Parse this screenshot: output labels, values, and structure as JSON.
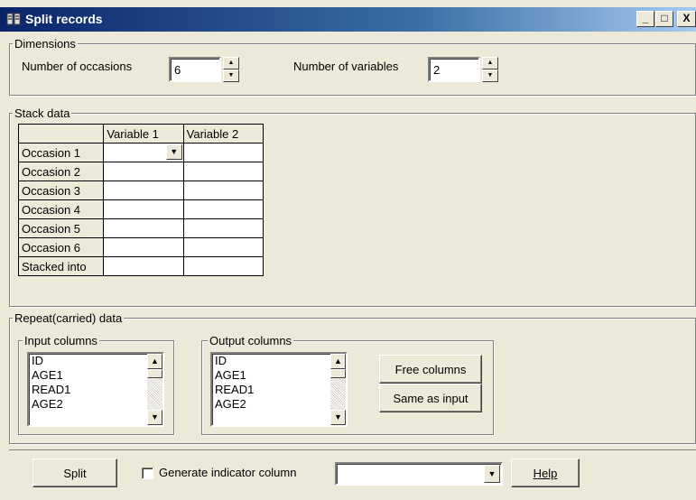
{
  "window": {
    "title": "Split records",
    "minimize_glyph": "_",
    "maximize_glyph": "□",
    "close_glyph": "X"
  },
  "dimensions": {
    "legend": "Dimensions",
    "occasions_label": "Number of occasions",
    "occasions_value": "6",
    "variables_label": "Number of variables",
    "variables_value": "2"
  },
  "stack": {
    "legend": "Stack data",
    "column_headers": [
      "Variable   1",
      "Variable   2"
    ],
    "row_headers": [
      "Occasion 1",
      "Occasion 2",
      "Occasion 3",
      "Occasion 4",
      "Occasion 5",
      "Occasion 6",
      "Stacked into"
    ]
  },
  "repeat": {
    "legend": "Repeat(carried) data",
    "input": {
      "legend": "Input columns",
      "items": [
        "ID",
        "AGE1",
        "READ1",
        "AGE2"
      ]
    },
    "output": {
      "legend": "Output columns",
      "items": [
        "ID",
        "AGE1",
        "READ1",
        "AGE2"
      ]
    },
    "free_columns_label": "Free columns",
    "same_as_input_label": "Same as input"
  },
  "footer": {
    "split_label": "Split",
    "indicator_label": "Generate indicator column",
    "indicator_checked": false,
    "indicator_select_value": "",
    "help_label": "Help"
  },
  "colors": {
    "titlebar_start": "#0a246a",
    "titlebar_end": "#a6caf0",
    "face": "#ece9d8"
  },
  "icons": {
    "app": "split-records-icon",
    "spin_up": "spin-up-arrow-icon",
    "spin_down": "spin-down-arrow-icon",
    "dropdown": "dropdown-arrow-icon"
  }
}
